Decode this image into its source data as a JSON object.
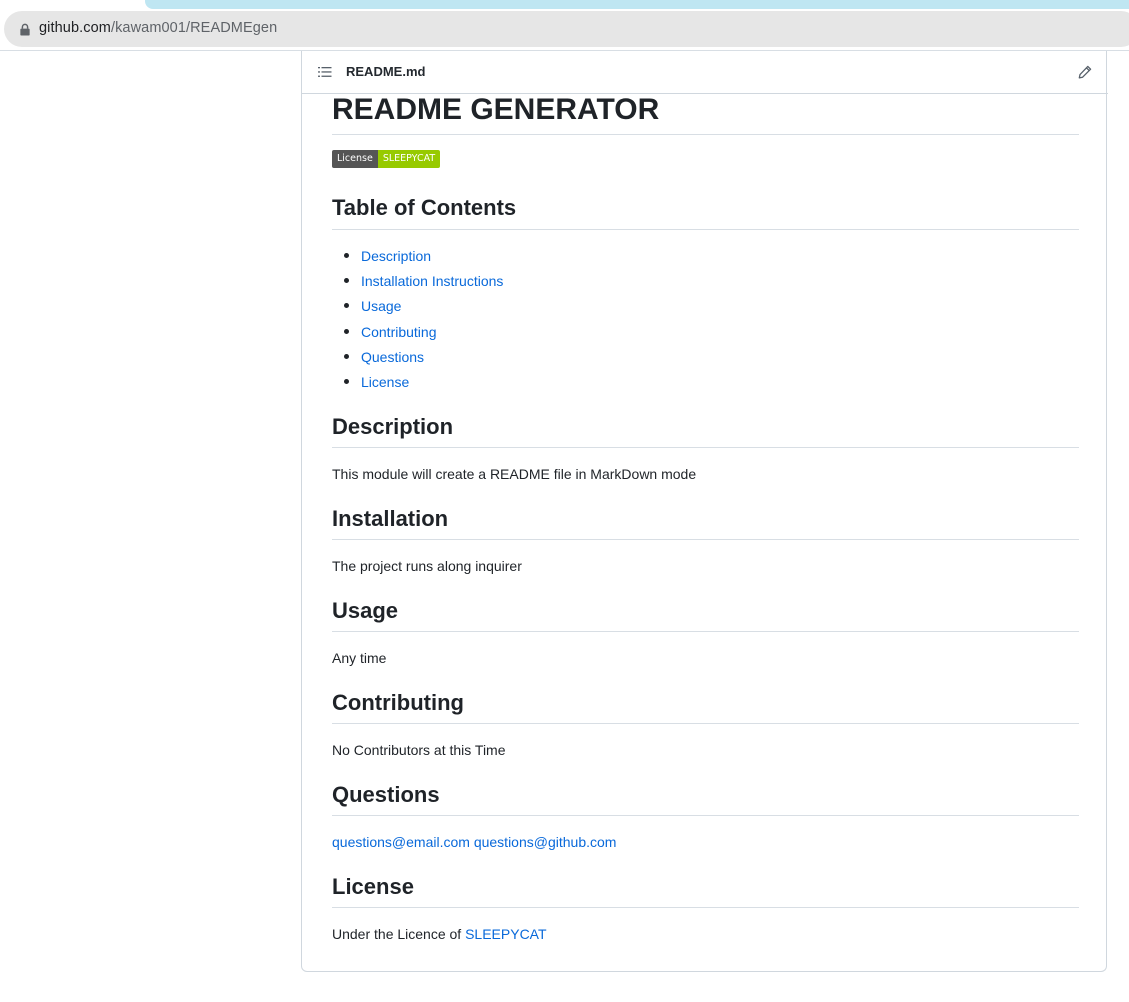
{
  "browser": {
    "url_host": "github.com",
    "url_path": "/kawam001/READMEgen"
  },
  "file": {
    "name": "README.md"
  },
  "readme": {
    "title": "README GENERATOR",
    "badge": {
      "label": "License",
      "value": "SLEEPYCAT",
      "label_color": "#555555",
      "value_color": "#97ca00"
    },
    "toc_heading": "Table of Contents",
    "toc": [
      {
        "label": "Description"
      },
      {
        "label": "Installation Instructions"
      },
      {
        "label": "Usage"
      },
      {
        "label": "Contributing"
      },
      {
        "label": "Questions"
      },
      {
        "label": "License"
      }
    ],
    "sections": {
      "description": {
        "heading": "Description",
        "text": "This module will create a README file in MarkDown mode"
      },
      "installation": {
        "heading": "Installation",
        "text": "The project runs along inquirer"
      },
      "usage": {
        "heading": "Usage",
        "text": "Any time"
      },
      "contributing": {
        "heading": "Contributing",
        "text": "No Contributors at this Time"
      },
      "questions": {
        "heading": "Questions",
        "email": "questions@email.com",
        "github": "questions@github.com"
      },
      "license": {
        "heading": "License",
        "text_prefix": "Under the Licence of ",
        "license_link": "SLEEPYCAT"
      }
    }
  },
  "colors": {
    "link": "#0969da",
    "text": "#1f2328",
    "border": "#d0d7de"
  }
}
